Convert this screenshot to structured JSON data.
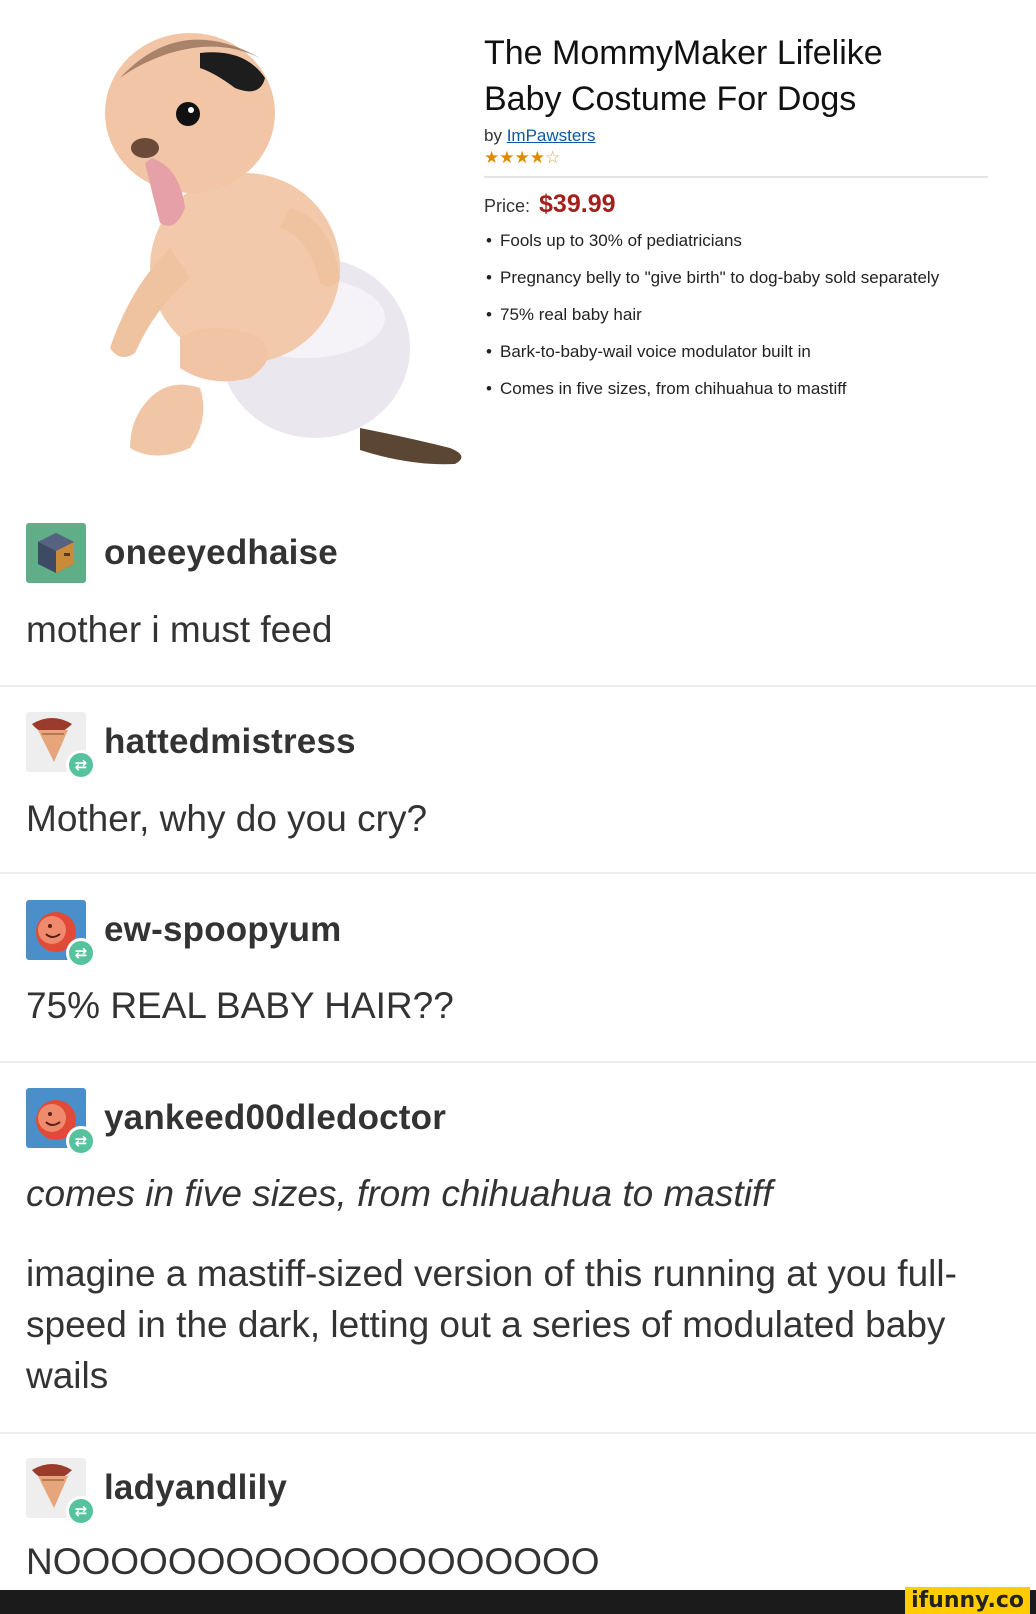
{
  "product": {
    "title_line1": "The MommyMaker Lifelike",
    "title_line2": "Baby Costume For Dogs",
    "by_label": "by",
    "brand": "ImPawsters",
    "rating": 3.5,
    "rating_max": 5,
    "price_label": "Price:",
    "price": "$39.99",
    "bullets": [
      "Fools up to 30% of pediatricians",
      "Pregnancy belly to \"give birth\" to dog-baby sold separately",
      "75% real baby hair",
      "Bark-to-baby-wail voice modulator built in",
      "Comes in five sizes, from chihuahua to mastiff"
    ]
  },
  "posts": [
    {
      "username": "oneeyedhaise",
      "text": "mother i must feed",
      "reblog": false,
      "avatar_icon": "cube-avatar-icon"
    },
    {
      "username": "hattedmistress",
      "text": "Mother, why do you cry?",
      "reblog": true,
      "avatar_icon": "ice-cream-avatar-icon"
    },
    {
      "username": "ew-spoopyum",
      "text": "75% REAL BABY HAIR??",
      "reblog": true,
      "avatar_icon": "face-avatar-icon"
    },
    {
      "username": "yankeed00dledoctor",
      "quote": "comes in five sizes, from chihuahua to mastiff",
      "text": "imagine a mastiff-sized version of this running at you full-speed in the dark, letting out a series of modulated baby wails",
      "reblog": true,
      "avatar_icon": "face-avatar-icon"
    },
    {
      "username": "ladyandlily",
      "text": "NOOOOOOOOOOOOOOOOOOO",
      "reblog": true,
      "avatar_icon": "ice-cream-avatar-icon"
    }
  ],
  "watermark": "ifunny.co",
  "colors": {
    "price": "#a3201e",
    "link": "#0d56a6",
    "reblog_badge": "#55c39e",
    "watermark_bg": "#ffcc00"
  }
}
